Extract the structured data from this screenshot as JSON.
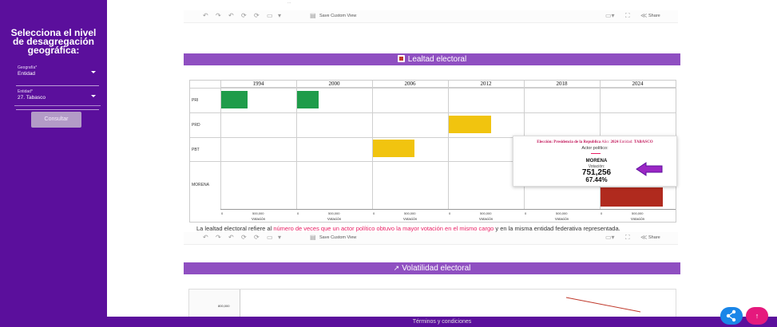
{
  "sidebar": {
    "title": "Selecciona el nivel de desagregación geográfica:",
    "geo_label": "Geografía*",
    "geo_value": "Entidad",
    "entity_label": "Entidad*",
    "entity_value": "27. Tabasco",
    "button": "Consultar"
  },
  "top_text": "...",
  "toolbar": {
    "save_view": "Save Custom View",
    "share": "Share"
  },
  "lealtad": {
    "header": "Lealtad electoral",
    "years": [
      "1994",
      "2000",
      "2006",
      "2012",
      "2018",
      "2024"
    ],
    "parties": [
      "PRI",
      "PRD",
      "PBT",
      "MORENA"
    ],
    "axis_ticks": [
      "0",
      "500,000"
    ],
    "axis_title": "Votación",
    "colors": {
      "PRI": "#1f9c4a",
      "PRD": "#f1c40f",
      "PBT": "#f1c40f",
      "MORENA": "#b02a1e"
    },
    "caption_pre": "La lealtad electoral refiere al ",
    "caption_hl": "número de veces que un actor político obtuvo la mayor votación en el mismo cargo",
    "caption_post": " y  en la misma entidad federativa representada."
  },
  "tooltip": {
    "eleccion_label": "Elección:",
    "eleccion": "Presidencia de la Republica",
    "anio_label": "Año:",
    "anio": "2024",
    "entidad_label": "Entidad:",
    "entidad": "TABASCO",
    "actor_label": "Actor político:",
    "actor": "MORENA",
    "votacion_label": "Votación:",
    "votes": "751,256",
    "pct": "67.44%"
  },
  "volatilidad": {
    "header": "Volatilidad electoral",
    "ytick": "800,000"
  },
  "footer": "Términos y condiciones"
}
